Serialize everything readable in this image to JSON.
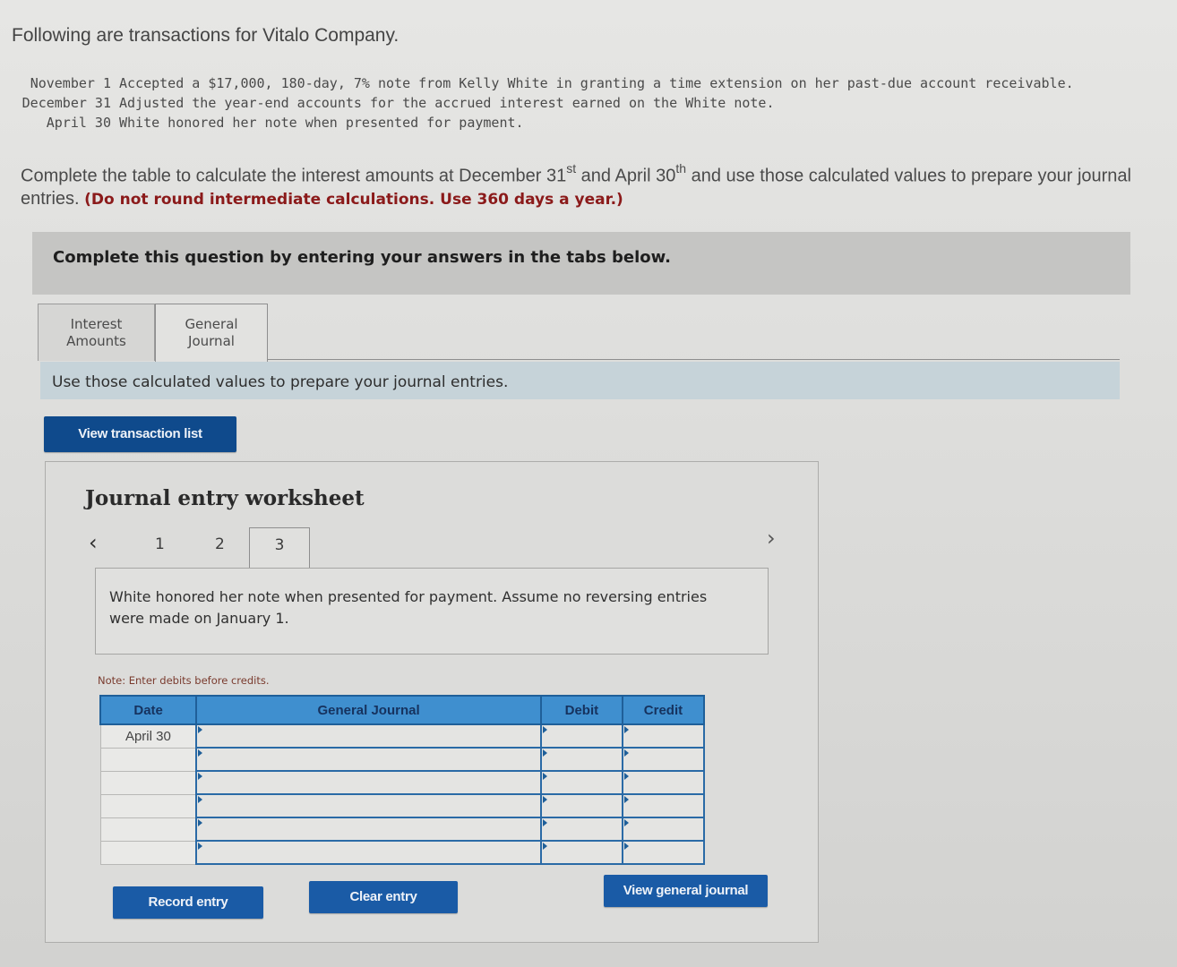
{
  "intro": "Following are transactions for Vitalo Company.",
  "transactions": [
    {
      "date": "November 1",
      "text": "Accepted a $17,000, 180-day, 7% note from Kelly White in granting a time extension on her past-due account receivable."
    },
    {
      "date": "December 31",
      "text": "Adjusted the year-end accounts for the accrued interest earned on the White note."
    },
    {
      "date": "April 30",
      "text": "White honored her note when presented for payment."
    }
  ],
  "instructions": {
    "part1": "Complete the table to calculate the interest amounts at December 31",
    "sup1": "st",
    "part2": " and April 30",
    "sup2": "th",
    "part3": " and use those calculated values to prepare your journal entries. ",
    "emphasis": "(Do not round intermediate calculations. Use 360 days a year.)"
  },
  "banner": "Complete this question by entering your answers in the tabs below.",
  "tabs": [
    {
      "line1": "Interest",
      "line2": "Amounts",
      "active": false
    },
    {
      "line1": "General",
      "line2": "Journal",
      "active": true
    }
  ],
  "tab_description": "Use those calculated values to prepare your journal entries.",
  "buttons": {
    "view_transaction_list": "View transaction list",
    "record_entry": "Record entry",
    "clear_entry": "Clear entry",
    "view_general_journal": "View general journal"
  },
  "worksheet": {
    "title": "Journal entry worksheet",
    "prev_icon": "chevron-left-icon",
    "next_icon": "chevron-right-icon",
    "pages": [
      "1",
      "2",
      "3"
    ],
    "current_page": "3",
    "description": "White honored her note when presented for payment. Assume no reversing entries were made on January 1.",
    "note": "Note: Enter debits before credits.",
    "table": {
      "headers": [
        "Date",
        "General Journal",
        "Debit",
        "Credit"
      ],
      "rows": [
        {
          "date": "April 30",
          "account": "",
          "debit": "",
          "credit": ""
        },
        {
          "date": "",
          "account": "",
          "debit": "",
          "credit": ""
        },
        {
          "date": "",
          "account": "",
          "debit": "",
          "credit": ""
        },
        {
          "date": "",
          "account": "",
          "debit": "",
          "credit": ""
        },
        {
          "date": "",
          "account": "",
          "debit": "",
          "credit": ""
        },
        {
          "date": "",
          "account": "",
          "debit": "",
          "credit": ""
        }
      ]
    }
  }
}
